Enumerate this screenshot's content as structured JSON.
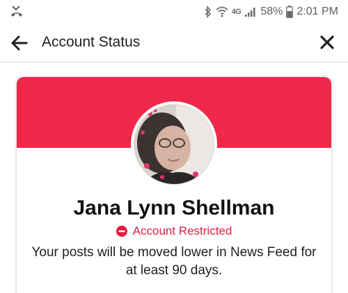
{
  "status_bar": {
    "network": "4G",
    "battery": "58%",
    "time": "2:01 PM"
  },
  "header": {
    "title": "Account Status",
    "back_icon": "back-arrow-icon",
    "close_icon": "close-icon"
  },
  "card": {
    "banner_color": "#f0284a",
    "name": "Jana Lynn Shellman",
    "status_label": "Account Restricted",
    "status_color": "#e41e3f",
    "status_icon": "restricted-icon",
    "description": "Your posts will be moved lower in News Feed for at least 90 days."
  }
}
